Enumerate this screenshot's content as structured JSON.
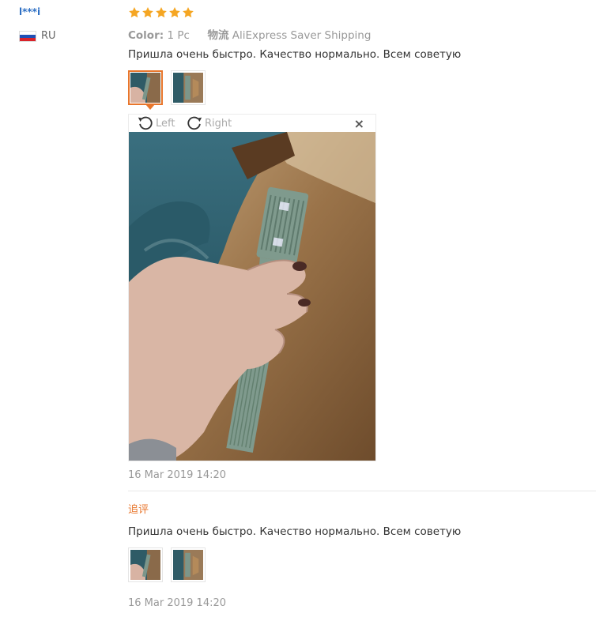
{
  "reviewer": {
    "name": "l***i",
    "country_code": "RU"
  },
  "rating": {
    "stars": 5,
    "color": "#f5a623"
  },
  "order": {
    "color_label": "Color:",
    "color_value": "1 Pc",
    "logistics_label": "物流",
    "logistics_value": "AliExpress Saver Shipping"
  },
  "review": {
    "text": "Пришла очень быстро. Качество нормально. Всем советую",
    "images": [
      "photo-hand-comb",
      "photo-comb-table"
    ],
    "date": "16 Mar 2019 14:20"
  },
  "viewer": {
    "rotate_left_label": "Left",
    "rotate_right_label": "Right",
    "close_symbol": "×"
  },
  "followup": {
    "label": "追评",
    "text": "Пришла очень быстро. Качество нормально. Всем советую",
    "images": [
      "photo-hand-comb",
      "photo-comb-table"
    ],
    "date": "16 Mar 2019 14:20"
  },
  "colors": {
    "accent": "#e8762c",
    "link": "#2d6fc4",
    "muted": "#999999"
  }
}
